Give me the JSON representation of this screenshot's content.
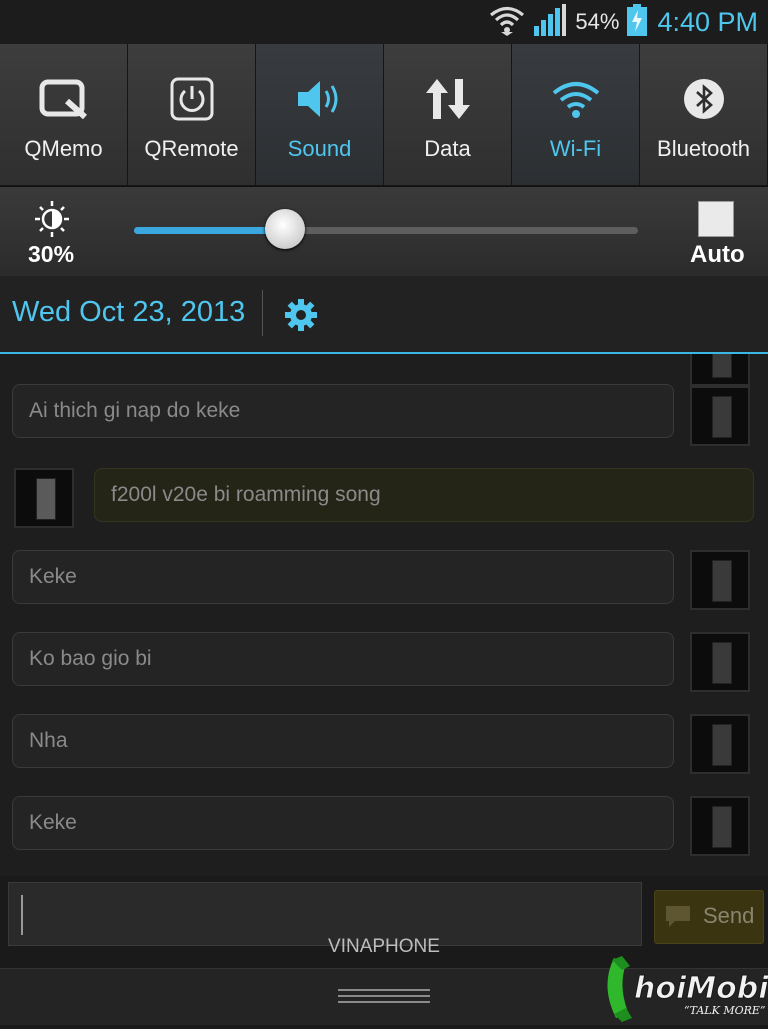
{
  "status_bar": {
    "icons": [
      "wifi-icon",
      "signal-icon",
      "battery-charging-icon"
    ],
    "battery_percent": "54%",
    "time": "4:40 PM"
  },
  "quick_toggles": [
    {
      "label": "QMemo",
      "icon": "qmemo-icon",
      "active": false
    },
    {
      "label": "QRemote",
      "icon": "qremote-icon",
      "active": false
    },
    {
      "label": "Sound",
      "icon": "speaker-icon",
      "active": true
    },
    {
      "label": "Data",
      "icon": "data-arrows-icon",
      "active": false
    },
    {
      "label": "Wi-Fi",
      "icon": "wifi-icon",
      "active": true
    },
    {
      "label": "Bluetooth",
      "icon": "bluetooth-icon",
      "active": false
    }
  ],
  "brightness": {
    "percent_label": "30%",
    "level": 0.3,
    "auto_label": "Auto",
    "auto_checked": false
  },
  "date_bar": {
    "date": "Wed Oct 23, 2013",
    "settings_icon": "gear-icon"
  },
  "messages": [
    {
      "text": "Ai thich gi nap do keke",
      "direction": "outgoing"
    },
    {
      "text": "f200l v20e bi roamming song",
      "direction": "incoming"
    },
    {
      "text": "Keke",
      "direction": "outgoing"
    },
    {
      "text": "Ko bao gio bi",
      "direction": "outgoing"
    },
    {
      "text": "Nha",
      "direction": "outgoing"
    },
    {
      "text": "Keke",
      "direction": "outgoing"
    }
  ],
  "composer": {
    "send_label": "Send",
    "send_icon": "message-icon"
  },
  "carrier": "VINAPHONE",
  "watermark": {
    "brand": "ChoiMobile",
    "tagline": "TALK MORE"
  },
  "colors": {
    "accent": "#4fc6ee",
    "slider_fill": "#3aa8df"
  }
}
